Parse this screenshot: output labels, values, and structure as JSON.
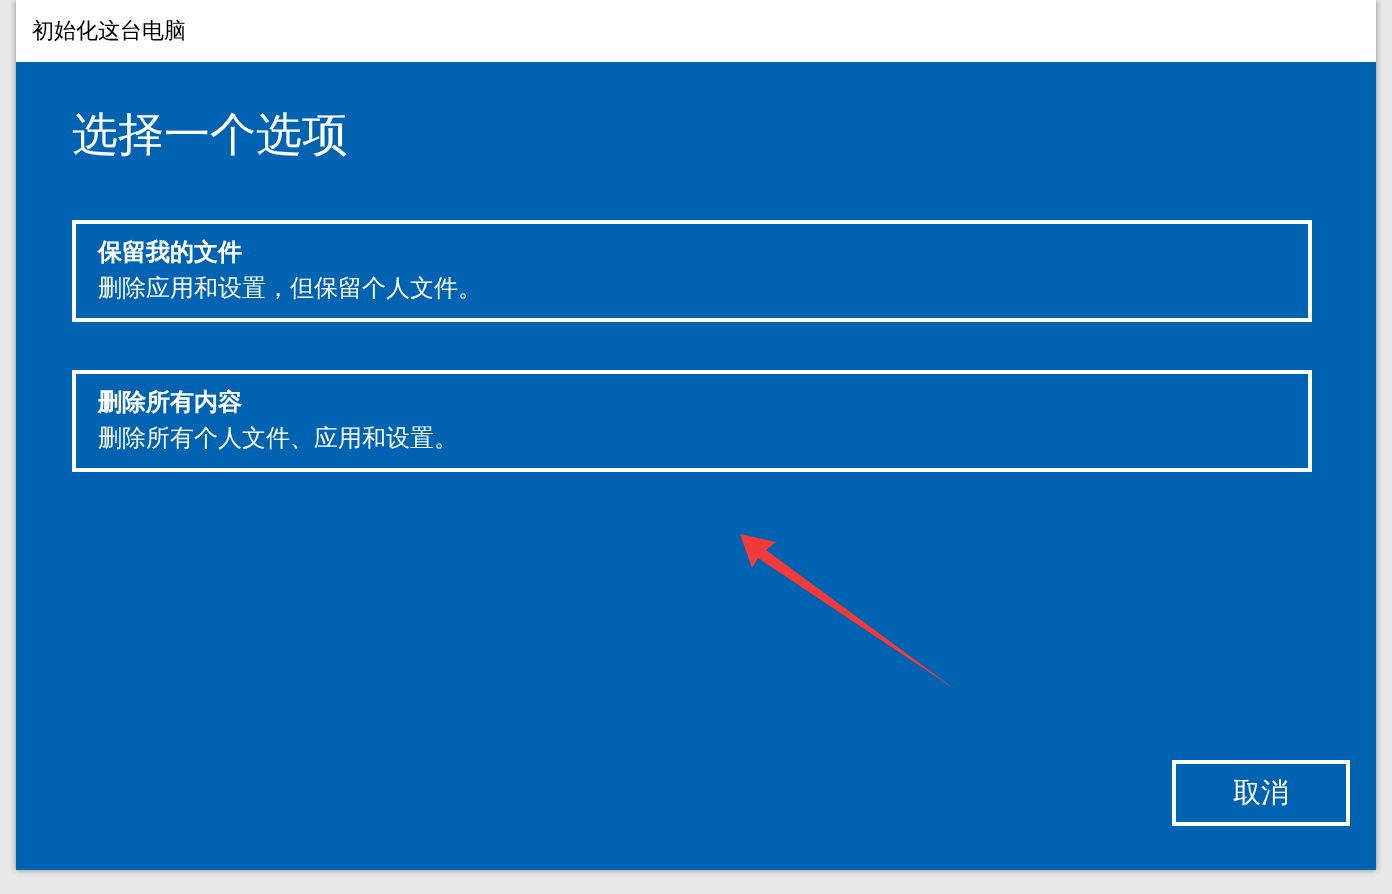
{
  "window": {
    "title": "初始化这台电脑"
  },
  "heading": "选择一个选项",
  "options": [
    {
      "title": "保留我的文件",
      "description": "删除应用和设置，但保留个人文件。"
    },
    {
      "title": "删除所有内容",
      "description": "删除所有个人文件、应用和设置。"
    }
  ],
  "buttons": [
    "取消"
  ]
}
